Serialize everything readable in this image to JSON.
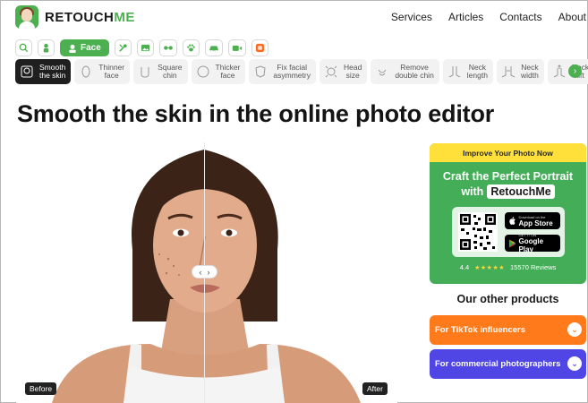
{
  "header": {
    "logo_part1": "RETOUCH",
    "logo_part2": "ME",
    "nav": [
      "Services",
      "Articles",
      "Contacts",
      "About"
    ]
  },
  "categories": {
    "active_label": "Face",
    "icons": [
      "search-icon",
      "person-icon",
      "face-icon",
      "tools-icon",
      "image-icon",
      "glasses-icon",
      "paw-icon",
      "car-icon",
      "video-icon",
      "orange-app-icon"
    ]
  },
  "tools": [
    {
      "label": "Smooth\nthe skin",
      "icon": "smooth-skin-icon",
      "active": true
    },
    {
      "label": "Thinner\nface",
      "icon": "thinner-face-icon"
    },
    {
      "label": "Square\nchin",
      "icon": "square-chin-icon"
    },
    {
      "label": "Thicker\nface",
      "icon": "thicker-face-icon"
    },
    {
      "label": "Fix facial\nasymmetry",
      "icon": "asymmetry-icon"
    },
    {
      "label": "Head\nsize",
      "icon": "head-size-icon"
    },
    {
      "label": "Remove\ndouble chin",
      "icon": "double-chin-icon"
    },
    {
      "label": "Neck\nlength",
      "icon": "neck-length-icon"
    },
    {
      "label": "Neck\nwidth",
      "icon": "neck-width-icon"
    },
    {
      "label": "Neck\nlift",
      "icon": "neck-lift-icon"
    }
  ],
  "title": "Smooth the skin in the online photo editor",
  "compare": {
    "before": "Before",
    "after": "After"
  },
  "promo": {
    "banner": "Improve Your Photo Now",
    "heading1": "Craft the Perfect Portrait",
    "heading2_prefix": "with",
    "brand": "RetouchMe",
    "app_store_small": "Download on the",
    "app_store": "App Store",
    "google_small": "GET IT ON",
    "google": "Google Play",
    "rating": "4.4",
    "reviews": "15570 Reviews"
  },
  "other_products": {
    "title": "Our other products",
    "items": [
      {
        "label": "For TikTok influencers",
        "color": "#ff7a1a"
      },
      {
        "label": "For commercial photographers",
        "color": "#4f46e5"
      }
    ]
  },
  "colors": {
    "brand_green": "#4caf50",
    "banner_yellow": "#ffe03a"
  }
}
